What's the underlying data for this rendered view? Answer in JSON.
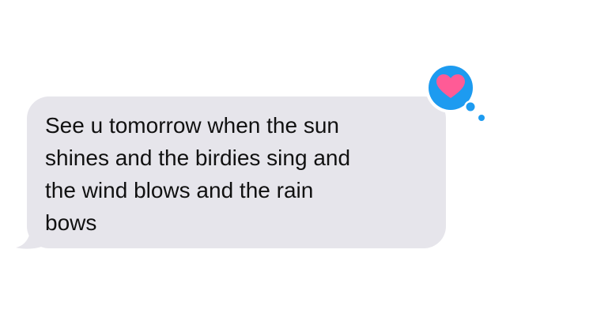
{
  "conversation": {
    "received_message": {
      "text": "See u tomorrow when the sun\nshines and the birdies sing and\nthe wind blows and the rain\nbows",
      "bubble_color": "#e6e5eb",
      "text_color": "#111111"
    },
    "tapback": {
      "icon": "heart-icon",
      "badge_color": "#1d9bf0",
      "heart_color": "#ff5b96"
    }
  }
}
